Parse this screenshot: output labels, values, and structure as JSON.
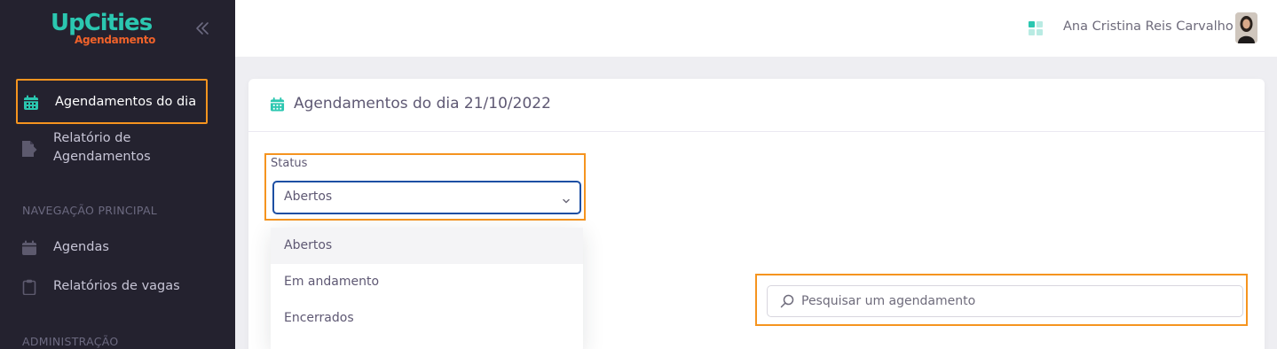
{
  "brand": {
    "name": "UpCities",
    "subtitle": "Agendamento",
    "primary_color": "#2bc7b0",
    "accent_color": "#f0622a"
  },
  "sidebar": {
    "collapse_icon": "chevrons-left-icon",
    "items": [
      {
        "label": "Agendamentos do dia",
        "icon": "calendar-icon",
        "active": true
      },
      {
        "label": "Relatório de Agendamentos",
        "label_line1": "Relatório de",
        "label_line2": "Agendamentos",
        "icon": "file-export-icon",
        "active": false
      }
    ],
    "sections": [
      {
        "title": "NAVEGAÇÃO PRINCIPAL",
        "items": [
          {
            "label": "Agendas",
            "icon": "calendar-icon"
          },
          {
            "label": "Relatórios de vagas",
            "icon": "clipboard-icon"
          }
        ]
      },
      {
        "title": "ADMINISTRAÇÃO",
        "items": []
      }
    ]
  },
  "topbar": {
    "apps_icon": "grid-icon",
    "user_name": "Ana Cristina Reis Carvalho"
  },
  "card": {
    "title": "Agendamentos do dia 21/10/2022",
    "status": {
      "label": "Status",
      "selected": "Abertos",
      "options": [
        "Abertos",
        "Em andamento",
        "Encerrados"
      ]
    },
    "search": {
      "placeholder": "Pesquisar um agendamento",
      "value": ""
    }
  },
  "highlight_color": "#f5941f"
}
